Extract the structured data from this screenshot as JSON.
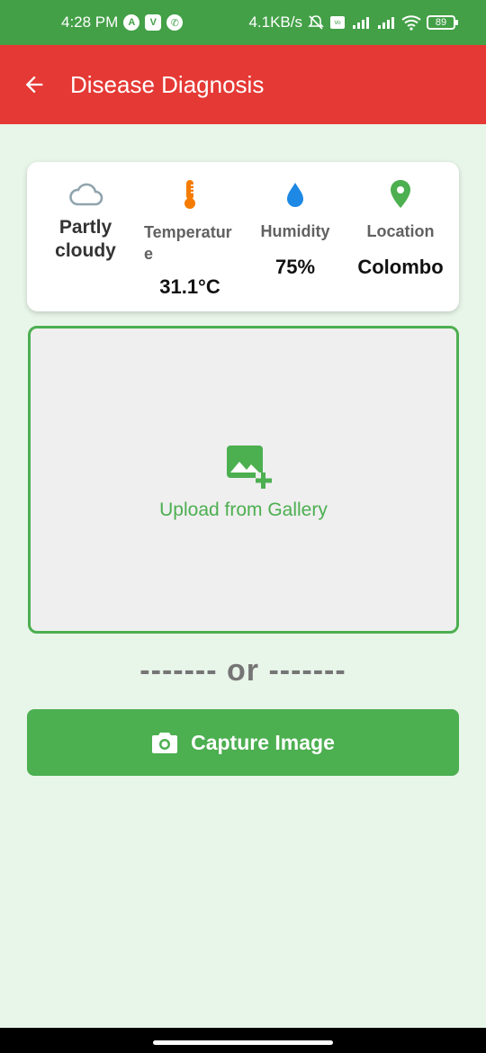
{
  "status_bar": {
    "time": "4:28 PM",
    "speed": "4.1KB/s",
    "battery": "89",
    "left_icons": [
      "a-icon",
      "v-icon",
      "whatsapp-icon"
    ],
    "right_icons": [
      "mute-icon",
      "volte-icon",
      "signal-icon",
      "signal-icon",
      "wifi-icon",
      "battery-icon"
    ]
  },
  "app_bar": {
    "title": "Disease Diagnosis",
    "back_icon": "arrow-left-icon",
    "color": "#e53935"
  },
  "weather": {
    "condition": "Partly cloudy",
    "condition_icon": "cloud-icon",
    "temperature_label": "Temperature",
    "temperature_value": "31.1°C",
    "temperature_icon": "thermometer-icon",
    "humidity_label": "Humidity",
    "humidity_value": "75%",
    "humidity_icon": "water-drop-icon",
    "location_label": "Location",
    "location_value": "Colombo",
    "location_icon": "location-pin-icon"
  },
  "upload": {
    "label": "Upload from Gallery",
    "icon": "add-photo-icon"
  },
  "divider": {
    "text": "------- or -------"
  },
  "capture": {
    "label": "Capture Image",
    "icon": "camera-icon"
  },
  "colors": {
    "primary_green": "#4caf50",
    "status_green": "#43a047",
    "background": "#e8f5e9",
    "red": "#e53935"
  }
}
